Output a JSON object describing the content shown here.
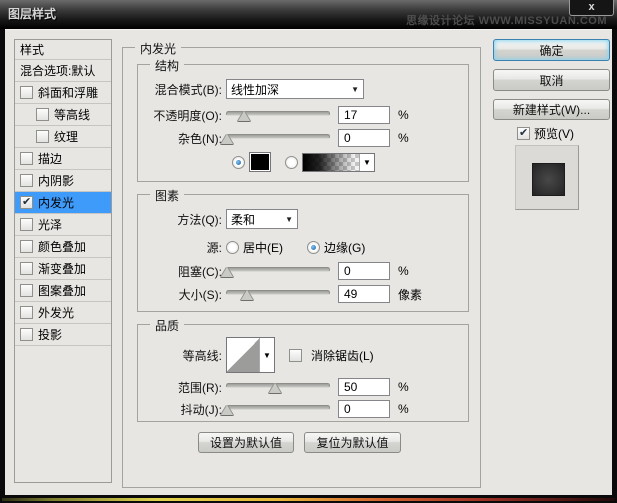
{
  "window": {
    "title": "图层样式",
    "watermark": "思缘设计论坛 WWW.MISSYUAN.COM",
    "close_glyph": "x"
  },
  "sidebar": {
    "header": "样式",
    "blending_options": "混合选项:默认",
    "items": [
      {
        "label": "斜面和浮雕",
        "checked": false,
        "indent": false,
        "selected": false
      },
      {
        "label": "等高线",
        "checked": false,
        "indent": true,
        "selected": false
      },
      {
        "label": "纹理",
        "checked": false,
        "indent": true,
        "selected": false
      },
      {
        "label": "描边",
        "checked": false,
        "indent": false,
        "selected": false
      },
      {
        "label": "内阴影",
        "checked": false,
        "indent": false,
        "selected": false
      },
      {
        "label": "内发光",
        "checked": true,
        "indent": false,
        "selected": true
      },
      {
        "label": "光泽",
        "checked": false,
        "indent": false,
        "selected": false
      },
      {
        "label": "颜色叠加",
        "checked": false,
        "indent": false,
        "selected": false
      },
      {
        "label": "渐变叠加",
        "checked": false,
        "indent": false,
        "selected": false
      },
      {
        "label": "图案叠加",
        "checked": false,
        "indent": false,
        "selected": false
      },
      {
        "label": "外发光",
        "checked": false,
        "indent": false,
        "selected": false
      },
      {
        "label": "投影",
        "checked": false,
        "indent": false,
        "selected": false
      }
    ]
  },
  "panel": {
    "title": "内发光",
    "structure": {
      "legend": "结构",
      "blend_mode_label": "混合模式(B):",
      "blend_mode_value": "线性加深",
      "opacity_label": "不透明度(O):",
      "opacity_value": "17",
      "opacity_unit": "%",
      "noise_label": "杂色(N):",
      "noise_value": "0",
      "noise_unit": "%",
      "color_swatch": "#000000",
      "color_selected": true,
      "gradient_selected": false
    },
    "elements": {
      "legend": "图素",
      "technique_label": "方法(Q):",
      "technique_value": "柔和",
      "source_label": "源:",
      "source_center_label": "居中(E)",
      "source_edge_label": "边缘(G)",
      "source_selected": "edge",
      "choke_label": "阻塞(C):",
      "choke_value": "0",
      "choke_unit": "%",
      "size_label": "大小(S):",
      "size_value": "49",
      "size_unit": "像素"
    },
    "quality": {
      "legend": "品质",
      "contour_label": "等高线:",
      "antialias_label": "消除锯齿(L)",
      "antialias_checked": false,
      "range_label": "范围(R):",
      "range_value": "50",
      "range_unit": "%",
      "jitter_label": "抖动(J):",
      "jitter_value": "0",
      "jitter_unit": "%"
    },
    "make_default_label": "设置为默认值",
    "reset_default_label": "复位为默认值"
  },
  "actions": {
    "ok": "确定",
    "cancel": "取消",
    "new_style": "新建样式(W)...",
    "preview": "预览(V)",
    "preview_checked": true
  },
  "sliders": {
    "opacity_pct": 17,
    "noise_pct": 1,
    "choke_pct": 1,
    "size_pct": 20,
    "range_pct": 47,
    "jitter_pct": 1
  },
  "colors": {
    "selection_blue": "#3f9bfa",
    "dialog_bg": "#e7e6e3"
  }
}
